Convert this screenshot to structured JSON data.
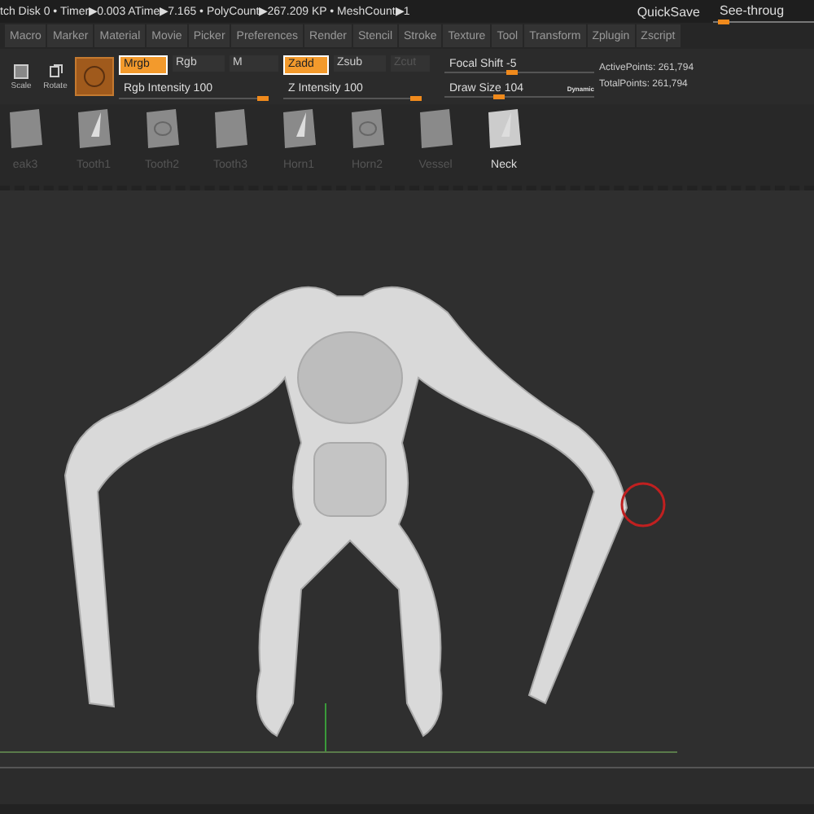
{
  "status_bar": {
    "text": "tch Disk 0 • Timer▶0.003 ATime▶7.165 • PolyCount▶267.209 KP • MeshCount▶1",
    "quick_save": "QuickSave",
    "see_through": {
      "label": "See-throug",
      "level": 0.05
    }
  },
  "menu": [
    {
      "label": "Macro"
    },
    {
      "label": "Marker"
    },
    {
      "label": "Material"
    },
    {
      "label": "Movie"
    },
    {
      "label": "Picker"
    },
    {
      "label": "Preferences"
    },
    {
      "label": "Render"
    },
    {
      "label": "Stencil"
    },
    {
      "label": "Stroke"
    },
    {
      "label": "Texture"
    },
    {
      "label": "Tool"
    },
    {
      "label": "Transform"
    },
    {
      "label": "Zplugin"
    },
    {
      "label": "Zscript"
    }
  ],
  "tools": [
    {
      "label": "Scale",
      "kind": "scale"
    },
    {
      "label": "Rotate",
      "kind": "rotate"
    }
  ],
  "color_modes": [
    {
      "label": "Mrgb",
      "selected": true,
      "disabled": false
    },
    {
      "label": "Rgb",
      "selected": false,
      "disabled": false
    },
    {
      "label": "M",
      "selected": false,
      "disabled": false
    }
  ],
  "sculpt_modes": [
    {
      "label": "Zadd",
      "selected": true,
      "disabled": false
    },
    {
      "label": "Zsub",
      "selected": false,
      "disabled": false
    },
    {
      "label": "Zcut",
      "selected": false,
      "disabled": true
    }
  ],
  "intensity_sliders": [
    {
      "label": "Rgb Intensity 100",
      "level": 1.0
    },
    {
      "label": "Z Intensity 100",
      "level": 1.0
    }
  ],
  "brush_sliders": [
    {
      "label": "Focal Shift -5",
      "level": 0.45
    },
    {
      "label": "Draw Size 104",
      "level": 0.35,
      "badge": "Dynamic"
    }
  ],
  "points": [
    "ActivePoints: 261,794",
    "TotalPoints: 261,794"
  ],
  "brushes": [
    {
      "label": "eak3",
      "selected": false
    },
    {
      "label": "Tooth1",
      "selected": false
    },
    {
      "label": "Tooth2",
      "selected": false
    },
    {
      "label": "Tooth3",
      "selected": false
    },
    {
      "label": "Horn1",
      "selected": false
    },
    {
      "label": "Horn2",
      "selected": false
    },
    {
      "label": "Vessel",
      "selected": false
    },
    {
      "label": "Neck",
      "selected": true
    }
  ]
}
